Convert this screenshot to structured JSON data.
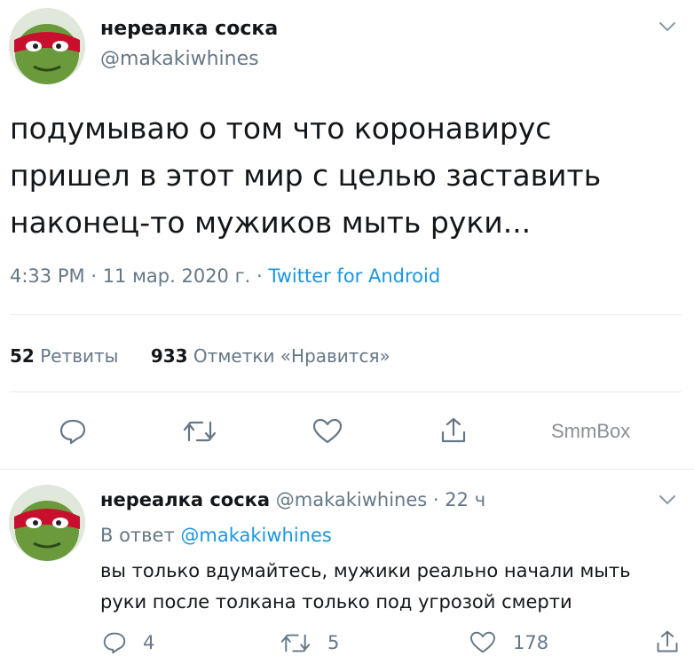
{
  "main_tweet": {
    "author_name": "нереалка соска",
    "author_handle": "@makakiwhines",
    "text_lines": [
      "подумываю о том что коронавирус",
      "пришел в этот мир с целью заставить",
      "наконец-то мужиков мыть руки..."
    ],
    "time": "4:33 PM",
    "sep1": "·",
    "date": "11 мар. 2020 г.",
    "sep2": "·",
    "source": "Twitter for Android",
    "retweets_count": "52",
    "retweets_label": "Ретвиты",
    "likes_count": "933",
    "likes_label": "Отметки «Нравится»",
    "watermark": "SmmBox",
    "icons": [
      "chevron-down",
      "reply",
      "retweet",
      "like",
      "share"
    ]
  },
  "reply_tweet": {
    "author_name": "нереалка соска",
    "author_handle": "@makakiwhines",
    "sep": "·",
    "age": "22 ч",
    "in_reply_prefix": "В ответ",
    "in_reply_handle": "@makakiwhines",
    "text_lines": [
      "вы только вдумайтесь, мужики реально начали мыть",
      "руки после толкана только под угрозой смерти"
    ],
    "reply_count": "4",
    "retweet_count": "5",
    "like_count": "178"
  },
  "colors": {
    "text": "#14171a",
    "muted": "#657786",
    "link": "#1b95e0",
    "divider": "#e6ecf0",
    "avatar_mask": "#c8102e",
    "avatar_skin": "#6a9a3c"
  }
}
